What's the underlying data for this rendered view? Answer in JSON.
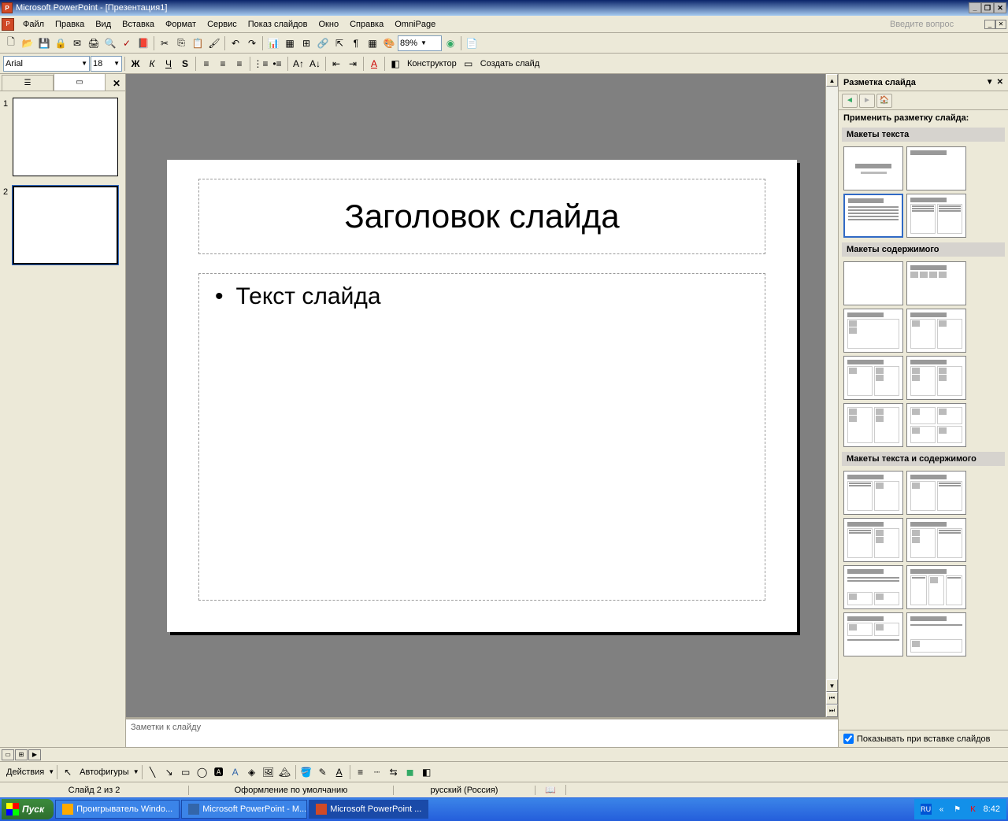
{
  "title": "Microsoft PowerPoint - [Презентация1]",
  "menus": [
    "Файл",
    "Правка",
    "Вид",
    "Вставка",
    "Формат",
    "Сервис",
    "Показ слайдов",
    "Окно",
    "Справка",
    "OmniPage"
  ],
  "ask_placeholder": "Введите вопрос",
  "zoom": "89%",
  "font": {
    "name": "Arial",
    "size": "18"
  },
  "format_buttons": {
    "bold": "Ж",
    "italic": "К",
    "underline": "Ч",
    "shadow": "S"
  },
  "constructor_label": "Конструктор",
  "new_slide_label": "Создать слайд",
  "slide": {
    "title": "Заголовок слайда",
    "body": "Текст слайда"
  },
  "thumbs": [
    "1",
    "2"
  ],
  "notes_placeholder": "Заметки к слайду",
  "task_pane": {
    "title": "Разметка слайда",
    "apply_label": "Применить разметку слайда:",
    "section1": "Макеты текста",
    "section2": "Макеты содержимого",
    "section3": "Макеты текста и содержимого",
    "show_on_insert": "Показывать при вставке слайдов"
  },
  "drawing": {
    "actions": "Действия",
    "autoshapes": "Автофигуры"
  },
  "status": {
    "slide": "Слайд 2 из 2",
    "design": "Оформление по умолчанию",
    "lang": "русский (Россия)"
  },
  "taskbar": {
    "start": "Пуск",
    "items": [
      "Проигрыватель Windo...",
      "Microsoft PowerPoint - М...",
      "Microsoft PowerPoint ..."
    ],
    "lang": "RU",
    "time": "8:42"
  }
}
